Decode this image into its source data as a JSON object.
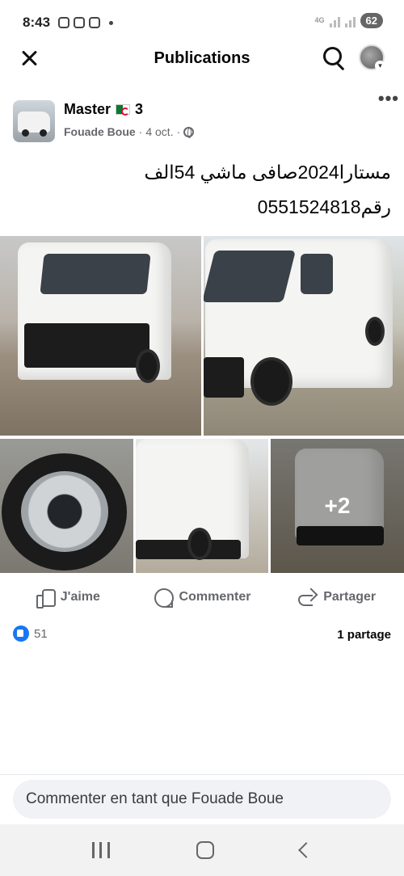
{
  "status_bar": {
    "time": "8:43",
    "network": "4G",
    "battery": "62"
  },
  "header": {
    "title": "Publications"
  },
  "post": {
    "author": {
      "name": "Master",
      "name_suffix": "3",
      "poster": "Fouade Boue",
      "date": "4 oct.",
      "separator": "·"
    },
    "text_line1": "مستارا2024صافى ماشي 54الف",
    "text_line2": "رقم0551524818",
    "more_photos": "+2"
  },
  "actions": {
    "like": "J'aime",
    "comment": "Commenter",
    "share": "Partager"
  },
  "stats": {
    "reactions_count": "51",
    "shares": "1 partage"
  },
  "comment_box": {
    "placeholder": "Commenter en tant que Fouade Boue"
  },
  "colors": {
    "accent": "#1877f2",
    "secondary_text": "#65676b"
  }
}
